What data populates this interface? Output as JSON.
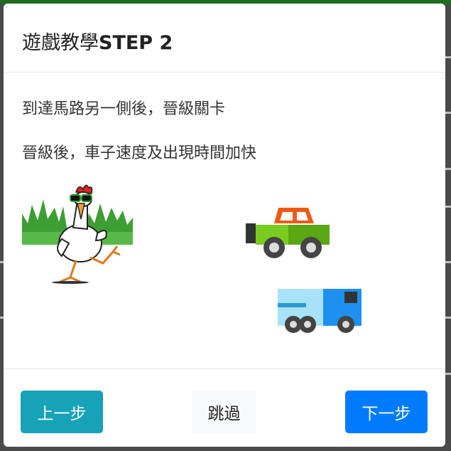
{
  "modal": {
    "title_prefix": "遊戲教學",
    "title_step": "STEP 2",
    "line1": "到達馬路另一側後，晉級關卡",
    "line2": "晉級後，車子速度及出現時間加快"
  },
  "footer": {
    "prev_label": "上一步",
    "skip_label": "跳過",
    "next_label": "下一步"
  },
  "colors": {
    "prev_button": "#17a2b8",
    "skip_button": "#f8f9fa",
    "next_button": "#007bff"
  },
  "icons": {
    "chicken": "chicken-on-grass-illustration",
    "car": "green-jeep-icon",
    "truck": "blue-truck-icon"
  }
}
